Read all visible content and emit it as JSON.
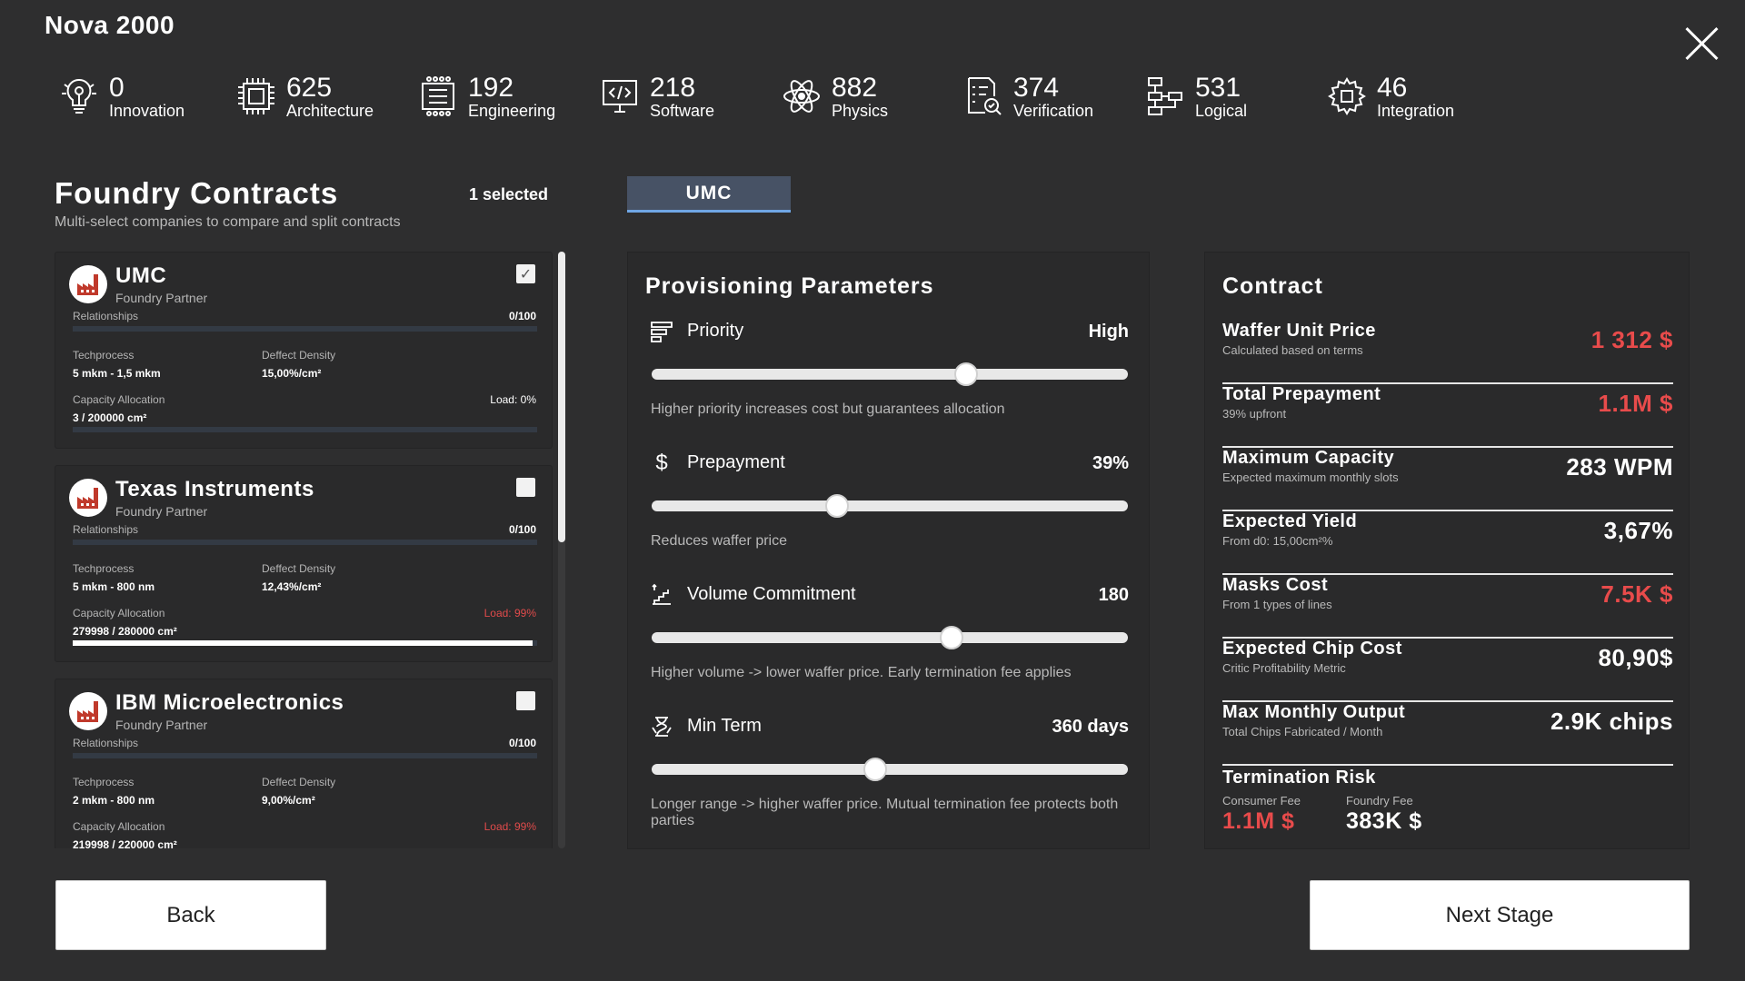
{
  "app": {
    "title": "Nova 2000"
  },
  "stats": [
    {
      "value": "0",
      "label": "Innovation",
      "icon": "lightbulb-icon"
    },
    {
      "value": "625",
      "label": "Architecture",
      "icon": "cpu-chip-icon"
    },
    {
      "value": "192",
      "label": "Engineering",
      "icon": "circuit-board-icon"
    },
    {
      "value": "218",
      "label": "Software",
      "icon": "monitor-code-icon"
    },
    {
      "value": "882",
      "label": "Physics",
      "icon": "atom-icon"
    },
    {
      "value": "374",
      "label": "Verification",
      "icon": "checklist-search-icon"
    },
    {
      "value": "531",
      "label": "Logical",
      "icon": "flowchart-icon"
    },
    {
      "value": "46",
      "label": "Integration",
      "icon": "gear-chip-icon"
    }
  ],
  "foundry": {
    "title": "Foundry Contracts",
    "subtitle": "Multi-select companies to compare and split contracts",
    "selected_count": "1 selected",
    "companies": [
      {
        "name": "UMC",
        "role": "Foundry Partner",
        "checked": true,
        "relationships_label": "Relationships",
        "relationships_value": "0/100",
        "techprocess_label": "Techprocess",
        "techprocess_value": "5 mkm - 1,5 mkm",
        "density_label": "Deffect Density",
        "density_value": "15,00%/cm²",
        "capacity_label": "Capacity Allocation",
        "capacity_value": "3 / 200000 cm²",
        "load": "Load: 0%",
        "load_high": false,
        "capacity_fraction": 0.0
      },
      {
        "name": "Texas Instruments",
        "role": "Foundry Partner",
        "checked": false,
        "relationships_label": "Relationships",
        "relationships_value": "0/100",
        "techprocess_label": "Techprocess",
        "techprocess_value": "5 mkm - 800 nm",
        "density_label": "Deffect Density",
        "density_value": "12,43%/cm²",
        "capacity_label": "Capacity Allocation",
        "capacity_value": "279998 / 280000 cm²",
        "load": "Load: 99%",
        "load_high": true,
        "capacity_fraction": 0.99
      },
      {
        "name": "IBM Microelectronics",
        "role": "Foundry Partner",
        "checked": false,
        "relationships_label": "Relationships",
        "relationships_value": "0/100",
        "techprocess_label": "Techprocess",
        "techprocess_value": "2 mkm - 800 nm",
        "density_label": "Deffect Density",
        "density_value": "9,00%/cm²",
        "capacity_label": "Capacity Allocation",
        "capacity_value": "219998 / 220000 cm²",
        "load": "Load: 99%",
        "load_high": true,
        "capacity_fraction": 0.99
      }
    ]
  },
  "tabs": [
    {
      "label": "UMC",
      "active": true
    }
  ],
  "provisioning": {
    "title": "Provisioning Parameters",
    "params": [
      {
        "label": "Priority",
        "value": "High",
        "description": "Higher priority increases cost but guarantees allocation",
        "icon": "priority-bars-icon",
        "level": 0.66
      },
      {
        "label": "Prepayment",
        "value": "39%",
        "description": "Reduces waffer price",
        "icon": "dollar-icon",
        "level": 0.39
      },
      {
        "label": "Volume Commitment",
        "value": "180",
        "description": "Higher volume -> lower waffer price. Early termination fee applies",
        "icon": "stairs-icon",
        "level": 0.63
      },
      {
        "label": "Min Term",
        "value": "360 days",
        "description": "Longer range -> higher waffer price.  Mutual termination fee protects both parties",
        "icon": "hourglass-icon",
        "level": 0.47
      }
    ]
  },
  "contract": {
    "title": "Contract",
    "rows": [
      {
        "label": "Waffer Unit Price",
        "sub": "Calculated based on terms",
        "value": "1 312 $",
        "red": true
      },
      {
        "label": "Total Prepayment",
        "sub": "39% upfront",
        "value": "1.1M $",
        "red": true
      },
      {
        "label": "Maximum Capacity",
        "sub": "Expected maximum monthly slots",
        "value": "283 WPM",
        "red": false
      },
      {
        "label": "Expected Yield",
        "sub": "From d0: 15,00cm²%",
        "value": "3,67%",
        "red": false
      },
      {
        "label": "Masks Cost",
        "sub": "From 1 types of lines",
        "value": "7.5K $",
        "red": true
      },
      {
        "label": "Expected Chip Cost",
        "sub": "Critic Profitability Metric",
        "value": "80,90$",
        "red": false
      },
      {
        "label": "Max Monthly Output",
        "sub": "Total Chips Fabricated / Month",
        "value": "2.9K chips",
        "red": false
      }
    ],
    "termination": {
      "label": "Termination Risk",
      "consumer_label": "Consumer Fee",
      "consumer_value": "1.1M $",
      "foundry_label": "Foundry Fee",
      "foundry_value": "383K $"
    }
  },
  "buttons": {
    "back": "Back",
    "next": "Next Stage"
  },
  "colors": {
    "background": "#2e2e2f",
    "panel": "#2a2a2b",
    "accent_red": "#e84b4b",
    "tab_active": "#475265",
    "tab_underline": "#6fa6e5"
  }
}
